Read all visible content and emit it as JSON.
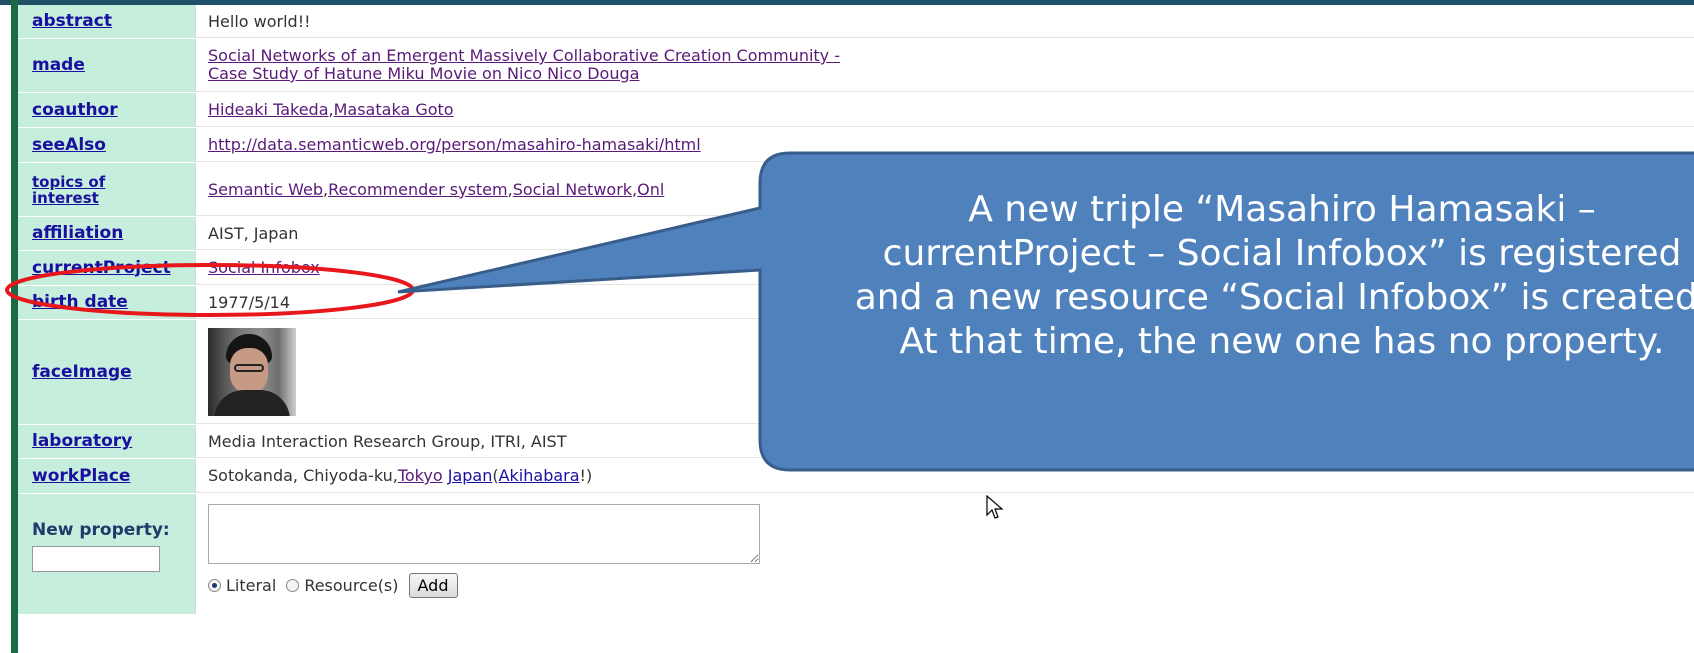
{
  "rows": [
    {
      "key": "abstract",
      "value": "Hello world!!"
    },
    {
      "key": "made",
      "links": [
        "Social Networks of an Emergent Massively Collaborative Creation Community -",
        "Case Study of Hatune Miku Movie on Nico Nico Douga"
      ]
    },
    {
      "key": "coauthor",
      "links": [
        "Hideaki Takeda",
        "Masataka Goto"
      ],
      "sep": ", "
    },
    {
      "key": "seeAlso",
      "link": "http://data.semanticweb.org/person/masahiro-hamasaki/html"
    },
    {
      "key_lines": [
        "topics of",
        "interest"
      ],
      "links": [
        "Semantic Web",
        "Recommender system",
        "Social Network",
        "Onl"
      ],
      "sep": ", "
    },
    {
      "key": "affiliation",
      "value": "AIST, Japan"
    },
    {
      "key": "currentProject",
      "link": "Social Infobox"
    },
    {
      "key": "birth date",
      "value": "1977/5/14"
    },
    {
      "key": "faceImage"
    },
    {
      "key": "laboratory",
      "value": "Media Interaction Research Group, ITRI, AIST"
    },
    {
      "key": "workPlace",
      "prefix": "Sotokanda, Chiyoda-ku, ",
      "link1": "Tokyo",
      "link2": "Japan",
      "paren_open": " (",
      "link3": "Akihabara",
      "suffix": "!)"
    }
  ],
  "new_property": {
    "label": "New property:",
    "radio_literal": "Literal",
    "radio_resource": "Resource(s)",
    "add_button": "Add"
  },
  "callout": {
    "lines": [
      "A new triple “Masahiro Hamasaki –",
      "currentProject – Social Infobox” is registered",
      "and a new resource “Social Infobox” is created.",
      "At that time, the new one has no property."
    ],
    "fill": "#4f81bd",
    "stroke": "#385d8a"
  },
  "highlight_color": "#e8171b"
}
